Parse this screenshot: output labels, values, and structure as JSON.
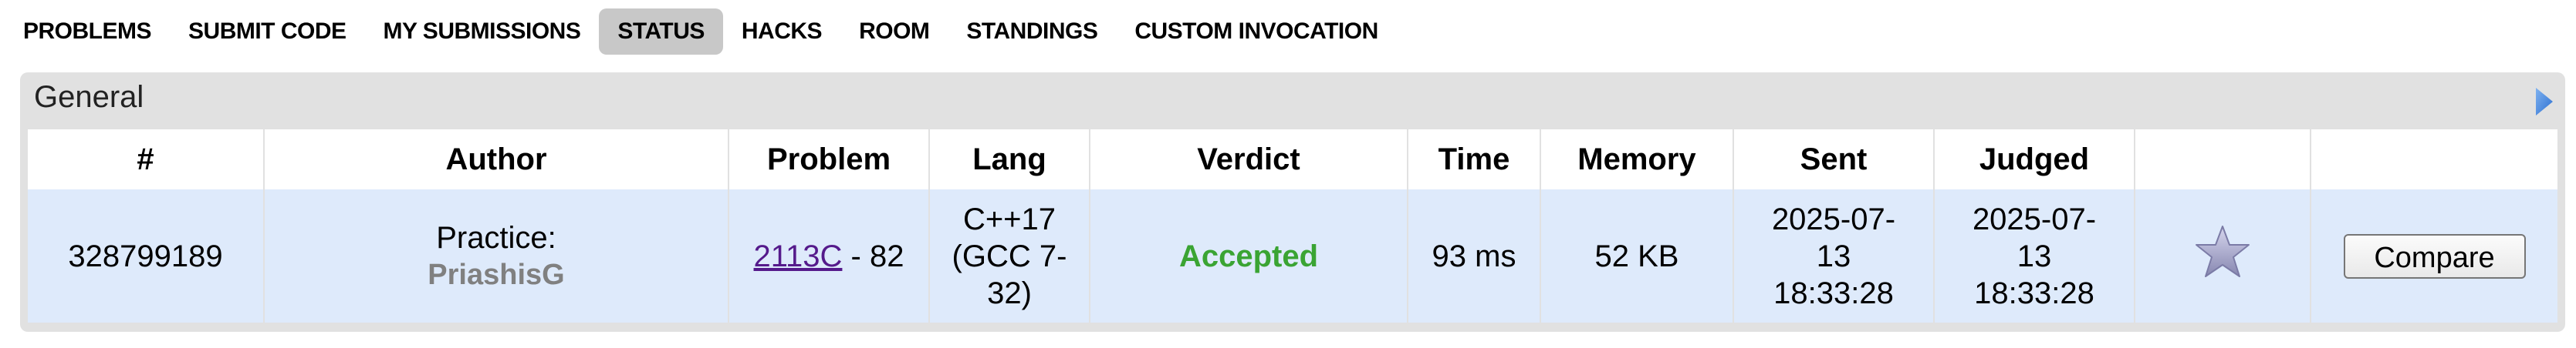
{
  "nav": {
    "items": [
      {
        "label": "PROBLEMS",
        "active": false
      },
      {
        "label": "SUBMIT CODE",
        "active": false
      },
      {
        "label": "MY SUBMISSIONS",
        "active": false
      },
      {
        "label": "STATUS",
        "active": true
      },
      {
        "label": "HACKS",
        "active": false
      },
      {
        "label": "ROOM",
        "active": false
      },
      {
        "label": "STANDINGS",
        "active": false
      },
      {
        "label": "CUSTOM INVOCATION",
        "active": false
      }
    ]
  },
  "panel": {
    "title": "General",
    "collapse_icon": "triangle-right-icon"
  },
  "table": {
    "headers": {
      "id": "#",
      "author": "Author",
      "problem": "Problem",
      "lang": "Lang",
      "verdict": "Verdict",
      "time": "Time",
      "memory": "Memory",
      "sent": "Sent",
      "judged": "Judged",
      "favourite": "",
      "compare": ""
    },
    "row": {
      "id": "328799189",
      "author_prefix": "Practice:",
      "author_name": "PriashisG",
      "problem_code": "2113C",
      "problem_suffix": " - 82",
      "lang": "C++17 (GCC 7-32)",
      "verdict": "Accepted",
      "time": "93 ms",
      "memory": "52 KB",
      "sent": "2025-07-13 18:33:28",
      "judged": "2025-07-13 18:33:28",
      "star_icon": "star-icon",
      "compare_label": "Compare"
    }
  },
  "colors": {
    "accepted": "#3aa433",
    "row_bg": "#deeafb",
    "panel_bg": "#e1e1e1",
    "active_tab_bg": "#c8c8c8",
    "link": "#551a8b",
    "author_name": "#808080"
  }
}
